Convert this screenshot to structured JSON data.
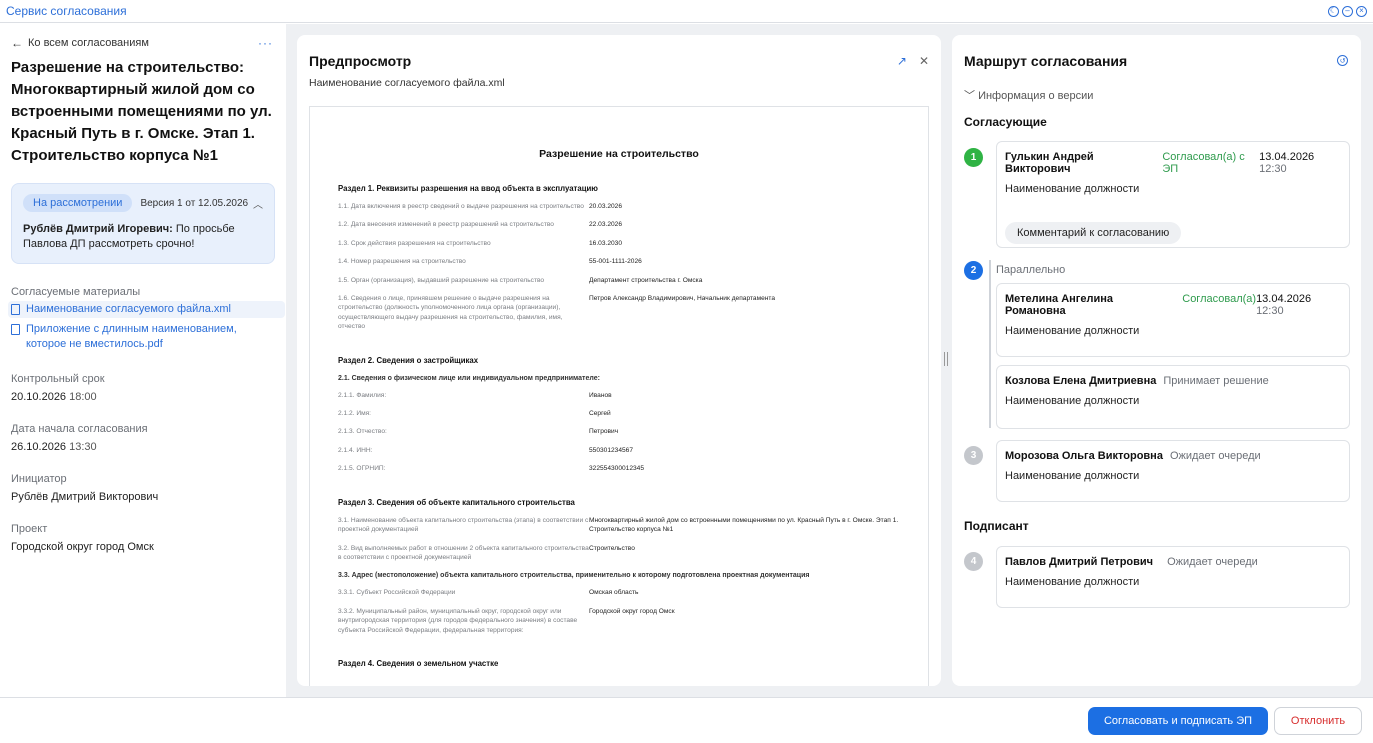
{
  "app_title": "Сервис согласования",
  "window_controls": [
    "theme-icon",
    "minimize-icon",
    "close-icon"
  ],
  "left": {
    "back_label": "Ко всем согласованиям",
    "more_label": "···",
    "title": "Разрешение на строительство: Многоквартирный жилой дом со встроенными помещениями по ул. Красный Путь в г. Омске. Этап 1. Строительство корпуса №1",
    "status": {
      "badge": "На рассмотрении",
      "version": "Версия 1 от 12.05.2026",
      "comment_author": "Рублёв Дмитрий Игоревич:",
      "comment_text": " По просьбе Павлова ДП рассмотреть срочно!"
    },
    "materials_label": "Согласуемые материалы",
    "files": [
      {
        "name": "Наименование согласуемого файла.xml"
      },
      {
        "name": "Приложение с длинным наименованием, которое не вместилось.pdf"
      }
    ],
    "fields": [
      {
        "label": "Контрольный срок",
        "date": "20.10.2026",
        "time": "18:00"
      },
      {
        "label": "Дата начала согласования",
        "date": "26.10.2026",
        "time": "13:30"
      },
      {
        "label": "Инициатор",
        "date": "Рублёв Дмитрий Викторович",
        "time": ""
      },
      {
        "label": "Проект",
        "date": "Городской округ город Омск",
        "time": ""
      }
    ]
  },
  "preview": {
    "title": "Предпросмотр",
    "file_name": "Наименование согласуемого файла.xml",
    "doc": {
      "title": "Разрешение на строительство",
      "s1": "Раздел 1. Реквизиты разрешения на ввод объекта в эксплуатацию",
      "s1_rows": [
        {
          "k": "1.1. Дата включения в реестр сведений о выдаче разрешения на строительство",
          "v": "20.03.2026"
        },
        {
          "k": "1.2. Дата внесения изменений в реестр разрешений на строительство",
          "v": "22.03.2026"
        },
        {
          "k": "1.3. Срок действия разрешения на строительство",
          "v": "16.03.2030"
        },
        {
          "k": "1.4. Номер разрешения на строительство",
          "v": "55-001-1111-2026"
        },
        {
          "k": "1.5. Орган (организация), выдавший разрешение на строительство",
          "v": "Департамент строительства г. Омска"
        },
        {
          "k": "1.6. Сведения о лице, принявшем решение о выдаче разрешения на строительство (должность уполномоченного лица органа (организации), осуществляющего выдачу разрешения на строительство, фамилия, имя, отчество",
          "v": "Петров Александр Владимирович, Начальник департамента"
        }
      ],
      "s2": "Раздел 2. Сведения о застройщиках",
      "s2_sub": "2.1. Сведения о физическом лице или индивидуальном предпринимателе:",
      "s2_rows": [
        {
          "k": "2.1.1. Фамилия:",
          "v": "Иванов"
        },
        {
          "k": "2.1.2. Имя:",
          "v": "Сергей"
        },
        {
          "k": "2.1.3. Отчество:",
          "v": "Петрович"
        },
        {
          "k": "2.1.4. ИНН:",
          "v": "550301234567"
        },
        {
          "k": "2.1.5. ОГРНИП:",
          "v": "322554300012345"
        }
      ],
      "s3": "Раздел 3. Сведения об объекте капитального строительства",
      "s3_rows": [
        {
          "k": "3.1. Наименование объекта капитального строительства (этапа) в соответствии с проектной документацией",
          "v": "Многоквартирный жилой дом со встроенными помещениями по ул. Красный Путь в г. Омске. Этап 1. Строительство корпуса №1"
        },
        {
          "k": "3.2. Вид выполняемых работ в отношении 2 объекта капитального строительства в соответствии с проектной документацией",
          "v": "Строительство"
        }
      ],
      "s3_sub": "3.3. Адрес (местоположение) объекта капитального строительства, применительно к которому подготовлена проектная документация",
      "s3_rows2": [
        {
          "k": "3.3.1. Субъект Российской Федерации",
          "v": "Омская область"
        },
        {
          "k": "3.3.2. Муниципальный район, муниципальный округ, городской округ или внутригородская территория (для городов федерального значения) в составе субъекта Российской Федерации, федеральная территория:",
          "v": "Городской округ город Омск"
        }
      ],
      "s4": "Раздел 4. Сведения о земельном участке"
    }
  },
  "route": {
    "title": "Маршрут согласования",
    "version_info": "Информация о версии",
    "approvers_label": "Согласующие",
    "signer_label": "Подписант",
    "parallel_label": "Параллельно",
    "steps": [
      {
        "num": "1",
        "color": "#2fb344",
        "name": "Гулькин Андрей Викторович",
        "status": "Согласовал(а) с ЭП",
        "date": "13.04.2026",
        "time": "12:30",
        "position": "Наименование должности",
        "comment": "Комментарий к согласованию"
      },
      {
        "num": "2",
        "color": "#1c6fe3",
        "name": "Метелина Ангелина Романовна",
        "status": "Согласовал(а)",
        "date": "13.04.2026",
        "time": "12:30",
        "position": "Наименование должности"
      },
      {
        "num": "",
        "name": "Козлова Елена Дмитриевна",
        "status": "Принимает решение",
        "position": "Наименование должности"
      },
      {
        "num": "3",
        "color": "#c4c7cc",
        "name": "Морозова Ольга Викторовна",
        "status": "Ожидает очереди",
        "position": "Наименование должности"
      },
      {
        "num": "4",
        "color": "#c4c7cc",
        "name": "Павлов Дмитрий Петрович",
        "status": "Ожидает очереди",
        "position": "Наименование должности"
      }
    ]
  },
  "footer": {
    "approve_label": "Согласовать и подписать ЭП",
    "reject_label": "Отклонить"
  }
}
